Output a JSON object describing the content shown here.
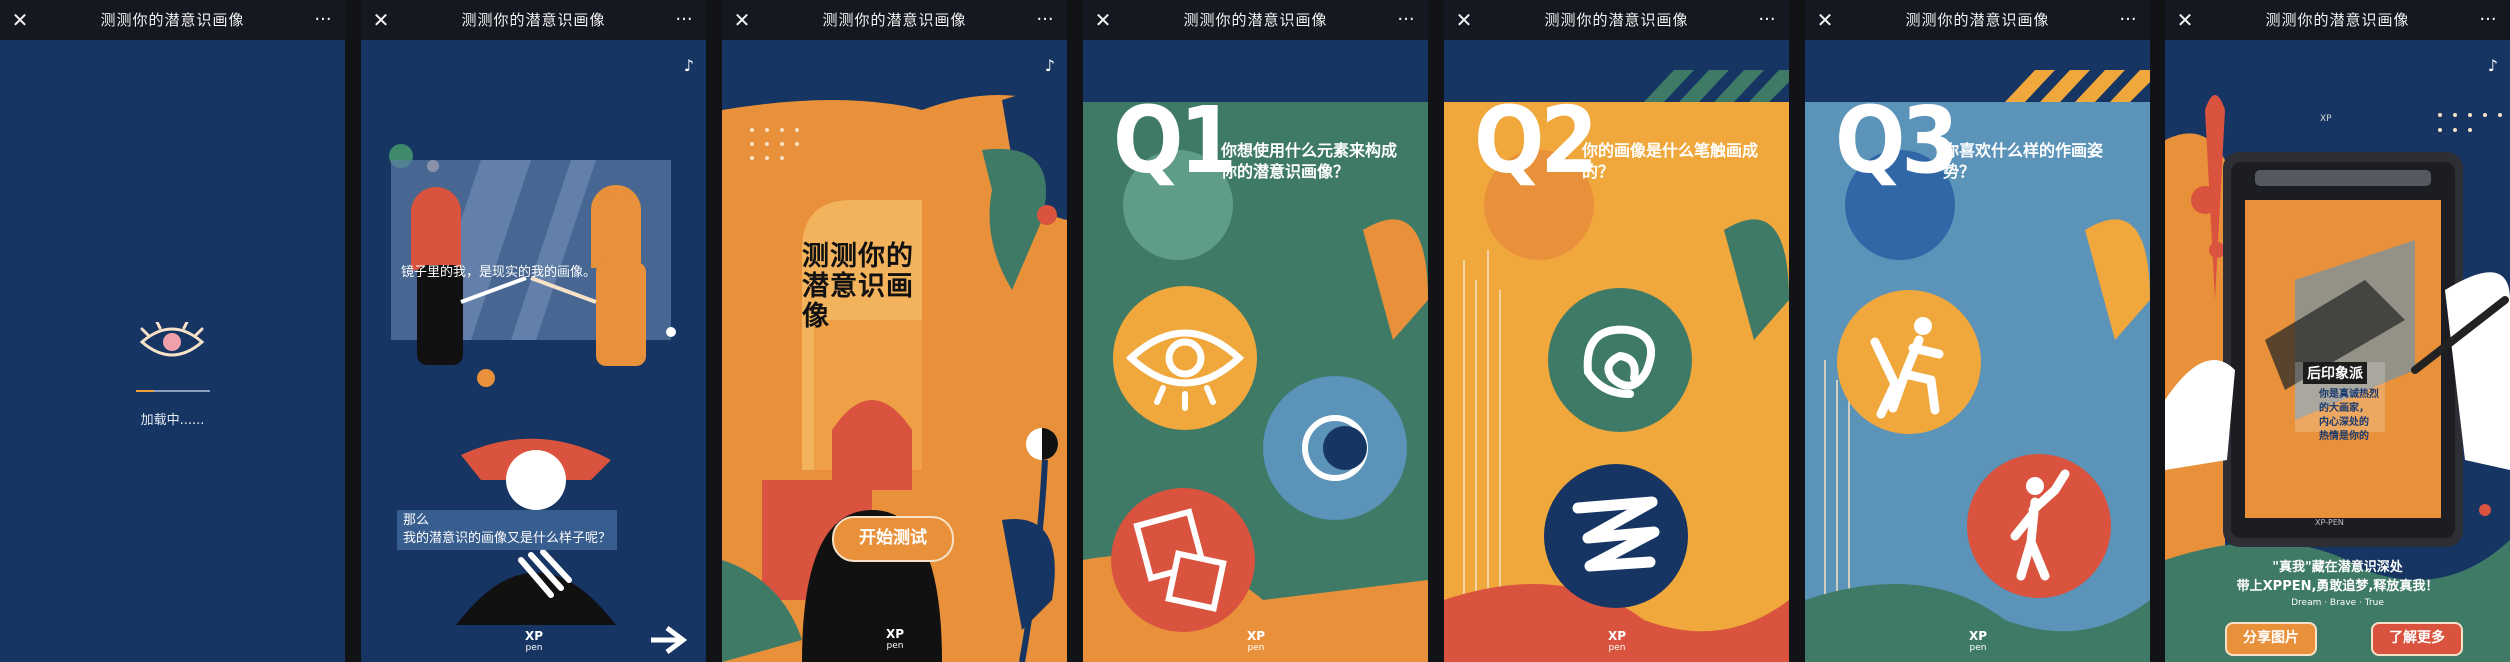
{
  "window": {
    "title": "测测你的潜意识画像",
    "close_glyph": "✕",
    "more_glyph": "···",
    "music_glyph": "♪"
  },
  "loading": {
    "text": "加载中......"
  },
  "intro": {
    "caption1": "镜子里的我，是现实的我的画像。",
    "caption2_line1": "那么",
    "caption2_line2": "我的潜意识的画像又是什么样子呢？"
  },
  "cover": {
    "headline_line1": "测测你的",
    "headline_line2": "潜意识画像",
    "start_label": "开始测试"
  },
  "brand": {
    "logo_top": "XP",
    "logo_bottom": "pen"
  },
  "questions": [
    {
      "number": "Q1",
      "text": "你想使用什么元素来构成你的潜意识画像？"
    },
    {
      "number": "Q2",
      "text": "你的画像是什么笔触画成的？"
    },
    {
      "number": "Q3",
      "text": "你喜欢什么样的作画姿势？"
    }
  ],
  "result": {
    "tablet_brand": "XP-PEN",
    "poster_label": "后印象派",
    "poster_lines": [
      "你是真诚热烈",
      "的大画家，",
      "内心深处的",
      "热情是你的"
    ],
    "line1": "\"真我\"藏在潜意识深处",
    "line2": "带上XPPEN,勇敢追梦,释放真我！",
    "line3": "Dream · Brave · True",
    "share_label": "分享图片",
    "more_label": "了解更多"
  },
  "colors": {
    "navy": "#163563",
    "orange": "#e8913a",
    "green": "#3f7a67",
    "yellow": "#f0a73c",
    "blue": "#5b93b9",
    "red": "#d9533e",
    "cream": "#f7e2c7"
  }
}
